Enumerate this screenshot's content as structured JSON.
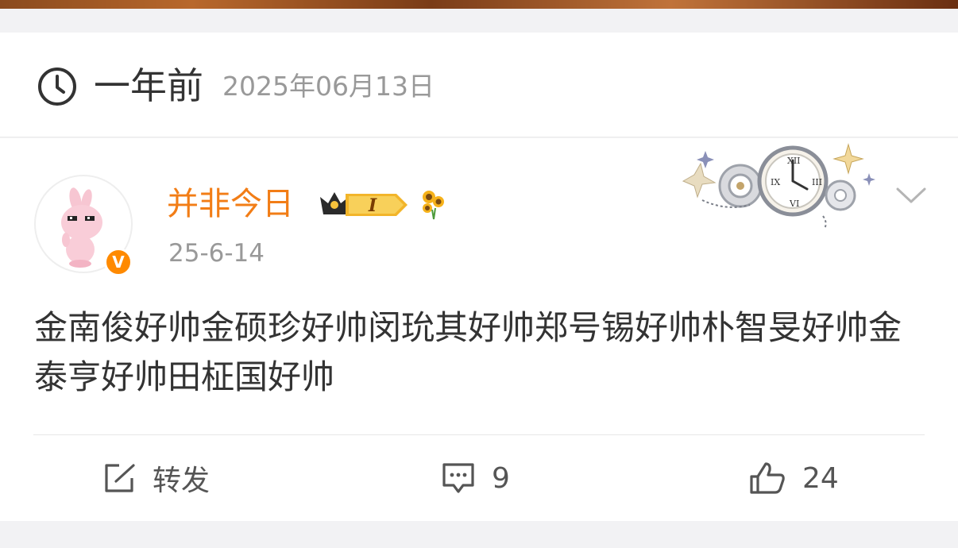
{
  "memory": {
    "relative_label": "一年前",
    "date": "2025年06月13日"
  },
  "post": {
    "username": "并非今日",
    "vip_level": "I",
    "verified_mark": "V",
    "time": "25-6-14",
    "text": "金南俊好帅金硕珍好帅闵玧其好帅郑号锡好帅朴智旻好帅金泰亨好帅田柾国好帅"
  },
  "actions": {
    "repost_label": "转发",
    "comment_count": "9",
    "like_count": "24"
  },
  "colors": {
    "username": "#f27d16",
    "verified": "#ff8a00",
    "text": "#333333",
    "muted": "#999999"
  },
  "icons": {
    "clock": "clock-icon",
    "verified": "verified-badge-icon",
    "vip": "crown-vip-icon",
    "flower": "sunflower-icon",
    "decoration": "clock-gear-decoration",
    "more": "chevron-down-icon",
    "repost": "share-edit-icon",
    "comment": "comment-icon",
    "like": "thumbs-up-icon"
  }
}
